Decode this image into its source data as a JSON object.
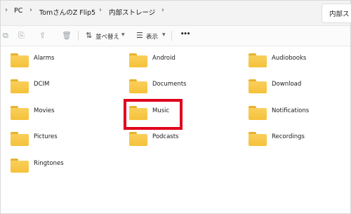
{
  "breadcrumb": {
    "items": [
      "PC",
      "TomさんのZ Flip5",
      "内部ストレージ"
    ]
  },
  "search": {
    "placeholder": "内部スト"
  },
  "toolbar": {
    "sort_label": "並べ替え",
    "view_label": "表示",
    "more_label": "•••"
  },
  "folders": [
    {
      "name": "Alarms"
    },
    {
      "name": "Android"
    },
    {
      "name": "Audiobooks"
    },
    {
      "name": "DCIM"
    },
    {
      "name": "Documents"
    },
    {
      "name": "Download"
    },
    {
      "name": "Movies"
    },
    {
      "name": "Music"
    },
    {
      "name": "Notifications"
    },
    {
      "name": "Pictures"
    },
    {
      "name": "Podcasts"
    },
    {
      "name": "Recordings"
    },
    {
      "name": "Ringtones"
    }
  ],
  "colors": {
    "folder": "#f8c94a",
    "highlight": "#e0001b"
  }
}
